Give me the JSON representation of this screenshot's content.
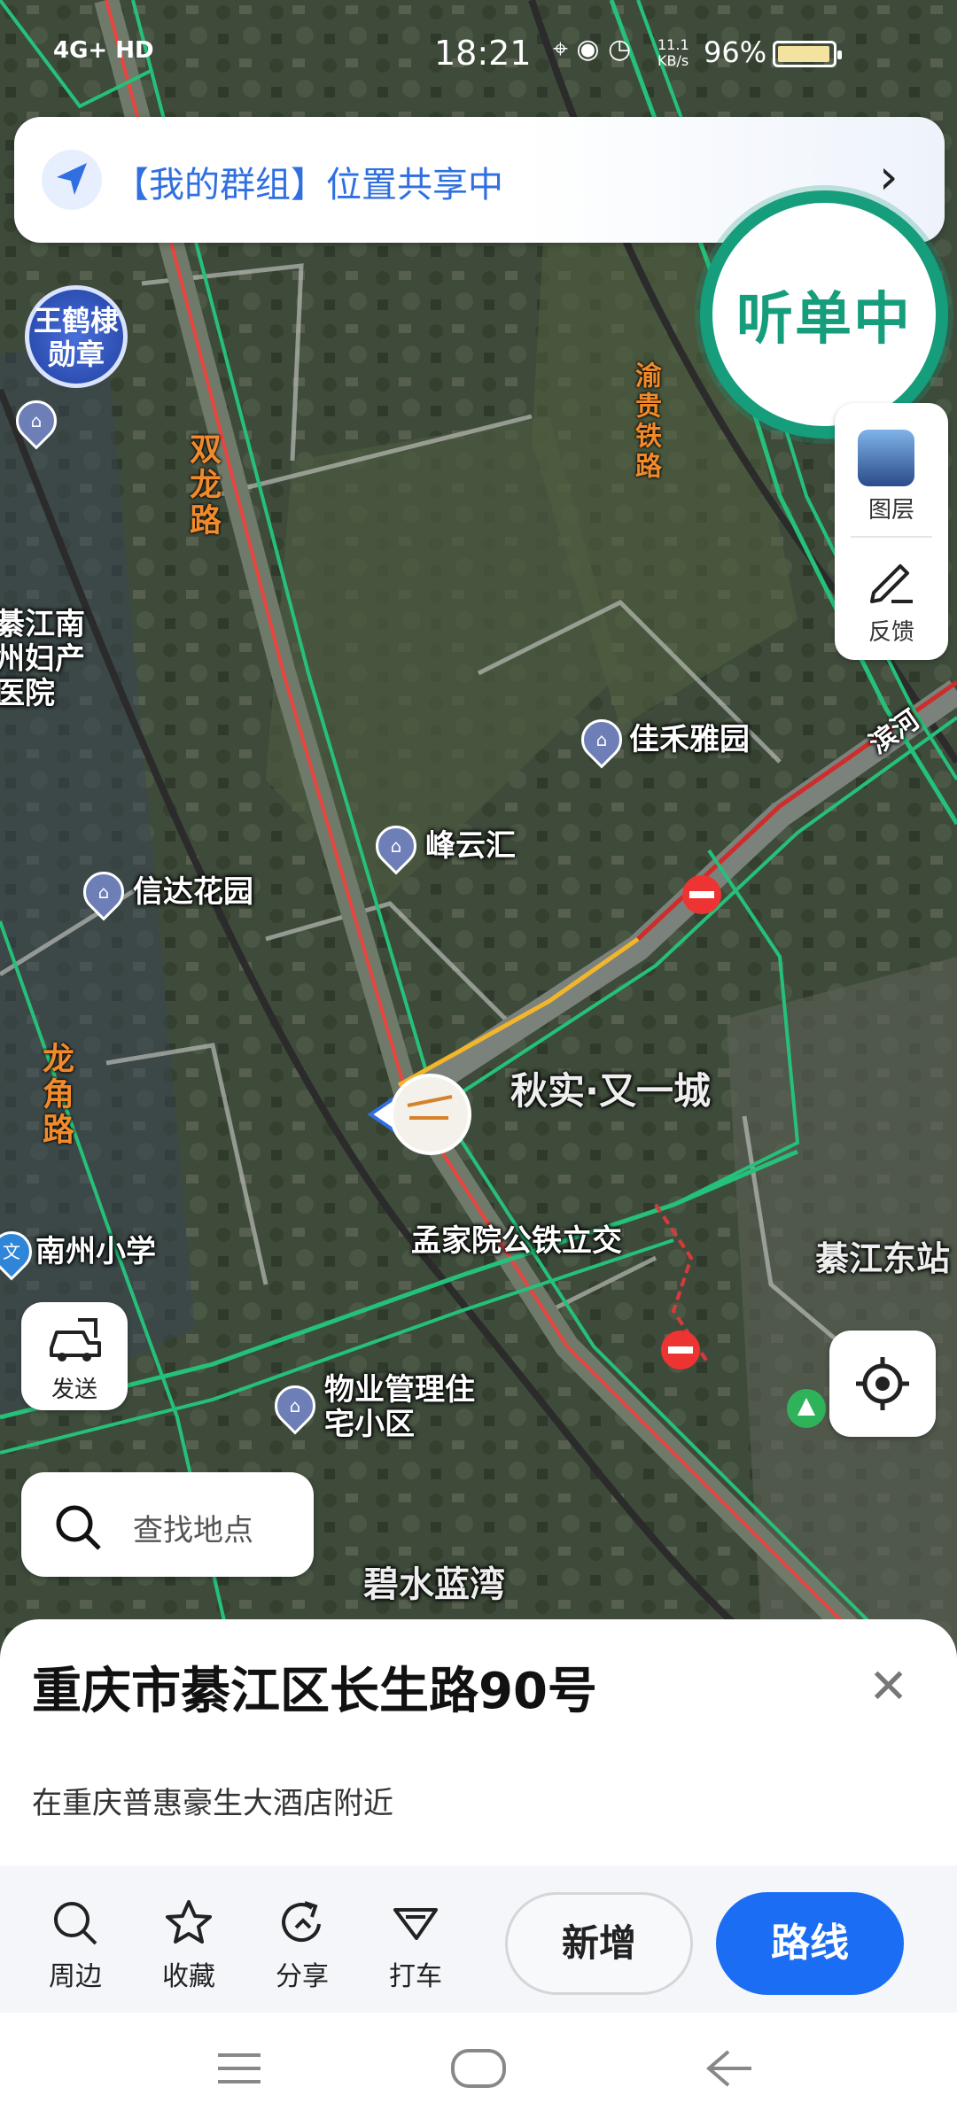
{
  "status_bar": {
    "signal": "4G+ HD",
    "time": "18:21",
    "net_speed": "11.1 KB/s",
    "battery": "96%",
    "battery_level": 0.96
  },
  "group_banner": {
    "text": "【我的群组】位置共享中"
  },
  "listen_badge": {
    "text": "听单中"
  },
  "side_panel": {
    "layers_label": "图层",
    "feedback_label": "反馈"
  },
  "medal": {
    "text": "王鹤棣 勋章"
  },
  "map": {
    "places": [
      {
        "id": "jiahe",
        "text": "佳禾雅园"
      },
      {
        "id": "fengyun",
        "text": "峰云汇"
      },
      {
        "id": "xinda",
        "text": "信达花园"
      },
      {
        "id": "qiushi",
        "text": "秋实·又一城"
      },
      {
        "id": "mengjia",
        "text": "孟家院公铁立交"
      },
      {
        "id": "nanzhou_school",
        "text": "南州小学"
      },
      {
        "id": "wuye",
        "text": "物业管理住宅小区"
      },
      {
        "id": "bishui",
        "text": "碧水蓝湾"
      },
      {
        "id": "qijiang_east",
        "text": "綦江东站"
      },
      {
        "id": "hospital",
        "text": "綦江南州妇产医院"
      }
    ],
    "roads": [
      {
        "id": "shuanglong",
        "text": "双龙路"
      },
      {
        "id": "yugui",
        "text": "渝贵铁路"
      },
      {
        "id": "longjiao",
        "text": "龙角路"
      },
      {
        "id": "binhe",
        "text": "滨河"
      }
    ]
  },
  "send_button": {
    "label": "发送"
  },
  "search": {
    "placeholder": "查找地点"
  },
  "sheet": {
    "title": "重庆市綦江区长生路90号",
    "subtitle": "在重庆普惠豪生大酒店附近",
    "actions": [
      {
        "label": "周边",
        "icon": "search-icon"
      },
      {
        "label": "收藏",
        "icon": "star-icon"
      },
      {
        "label": "分享",
        "icon": "share-icon"
      },
      {
        "label": "打车",
        "icon": "taxi-icon"
      }
    ],
    "add_label": "新增",
    "route_label": "路线"
  },
  "colors": {
    "accent": "#1b6ef3",
    "listen": "#159d7c",
    "link": "#2f6fe0"
  }
}
